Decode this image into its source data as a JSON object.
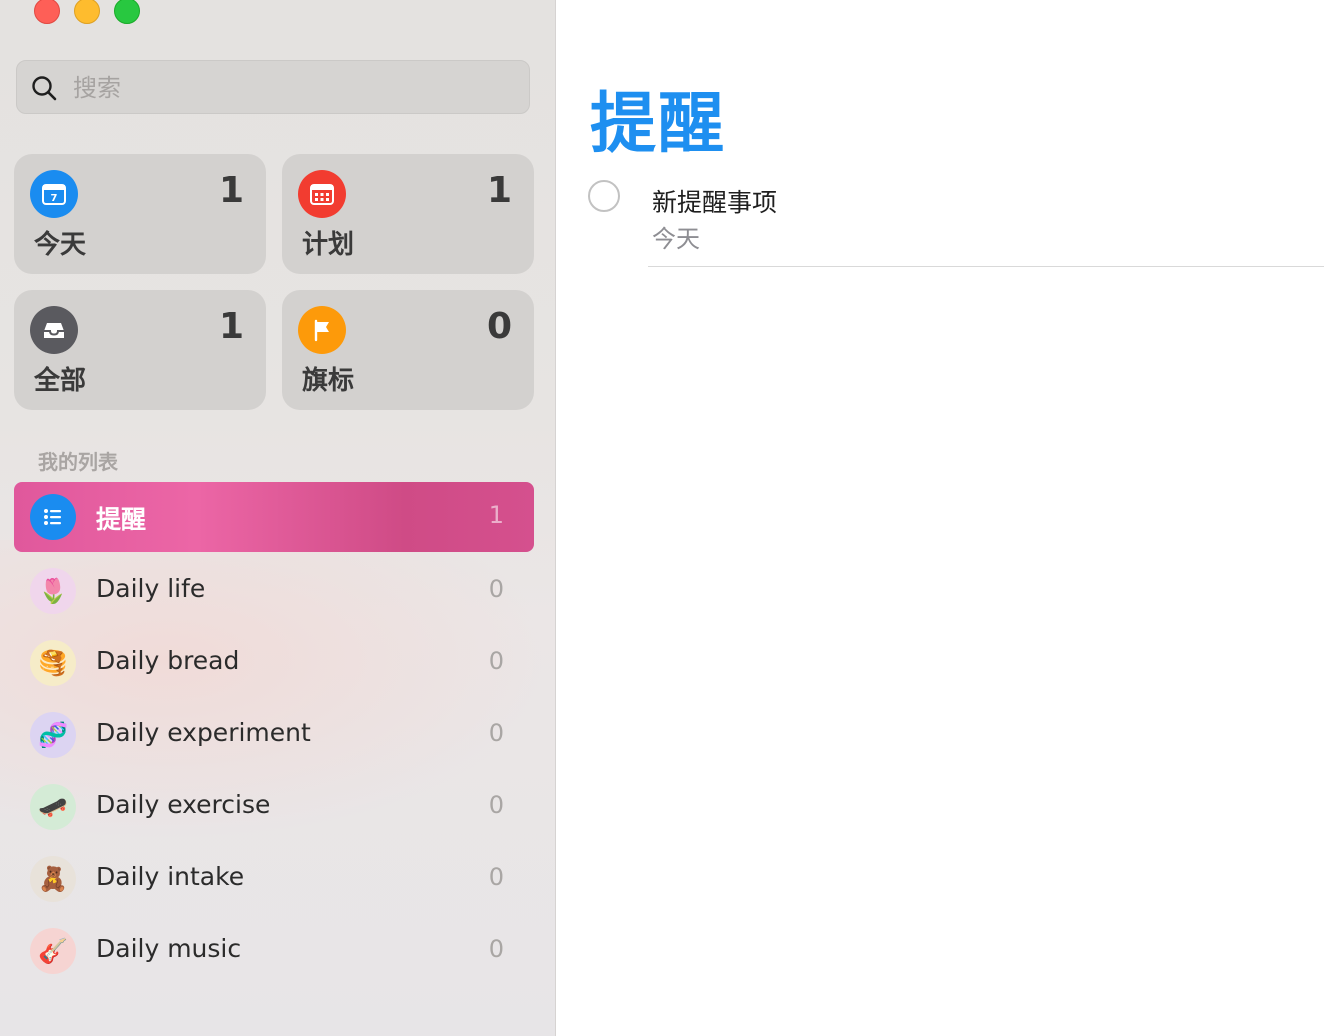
{
  "window": {
    "controls": [
      "close",
      "minimize",
      "zoom"
    ]
  },
  "search": {
    "placeholder": "搜索",
    "value": ""
  },
  "smart_lists": [
    {
      "id": "today",
      "label": "今天",
      "count": "1",
      "icon": "calendar-today-icon",
      "color": "#1a8cf0"
    },
    {
      "id": "scheduled",
      "label": "计划",
      "count": "1",
      "icon": "calendar-grid-icon",
      "color": "#f23c30"
    },
    {
      "id": "all",
      "label": "全部",
      "count": "1",
      "icon": "tray-icon",
      "color": "#5a5a5f"
    },
    {
      "id": "flagged",
      "label": "旗标",
      "count": "0",
      "icon": "flag-icon",
      "color": "#fd9a0a"
    }
  ],
  "my_lists": {
    "heading": "我的列表",
    "items": [
      {
        "label": "提醒",
        "count": "1",
        "icon": "list-bullet-icon",
        "emoji": "",
        "active": true
      },
      {
        "label": "Daily life",
        "count": "0",
        "icon": "tulip-icon",
        "emoji": "🌷"
      },
      {
        "label": "Daily bread",
        "count": "0",
        "icon": "pancakes-icon",
        "emoji": "🥞"
      },
      {
        "label": "Daily experiment",
        "count": "0",
        "icon": "dna-icon",
        "emoji": "🧬"
      },
      {
        "label": "Daily exercise",
        "count": "0",
        "icon": "skateboard-icon",
        "emoji": "🛹"
      },
      {
        "label": "Daily intake",
        "count": "0",
        "icon": "teddy-bear-icon",
        "emoji": "🧸"
      },
      {
        "label": "Daily music",
        "count": "0",
        "icon": "guitar-icon",
        "emoji": "🎸"
      }
    ]
  },
  "main": {
    "title": "提醒",
    "title_color": "#1e8ff0",
    "reminders": [
      {
        "title": "新提醒事项",
        "subtitle": "今天",
        "completed": false
      }
    ]
  },
  "colors": {
    "accent_active_list": "#e0589c",
    "list_icon_blue": "#1a8cf0"
  }
}
